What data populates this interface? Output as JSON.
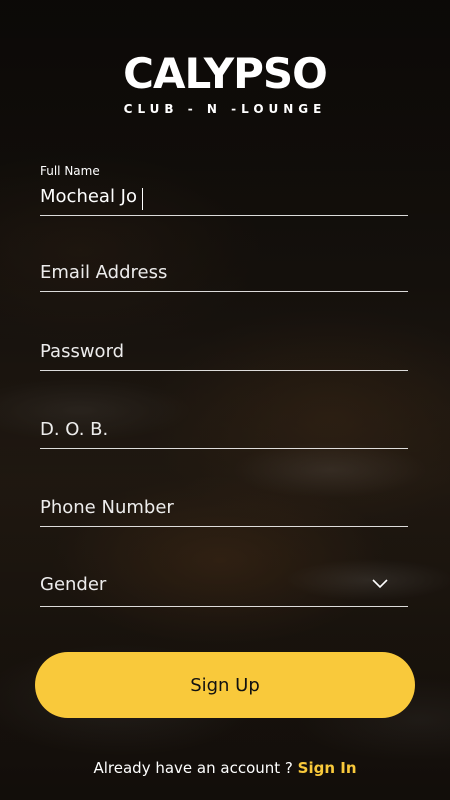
{
  "brand": {
    "name": "CALYPSO",
    "tagline": "CLUB - N -LOUNGE"
  },
  "form": {
    "full_name_label": "Full Name",
    "full_name_value": "Mocheal Jo",
    "email_placeholder": "Email Address",
    "password_placeholder": "Password",
    "dob_placeholder": "D. O. B.",
    "phone_placeholder": "Phone Number",
    "gender_value": "Gender"
  },
  "actions": {
    "signup_label": "Sign Up",
    "already_text": "Already have an account ?",
    "signin_link": "Sign In"
  },
  "colors": {
    "accent": "#f9c93b"
  },
  "icons": {
    "gender_dropdown": "chevron-down-icon"
  }
}
